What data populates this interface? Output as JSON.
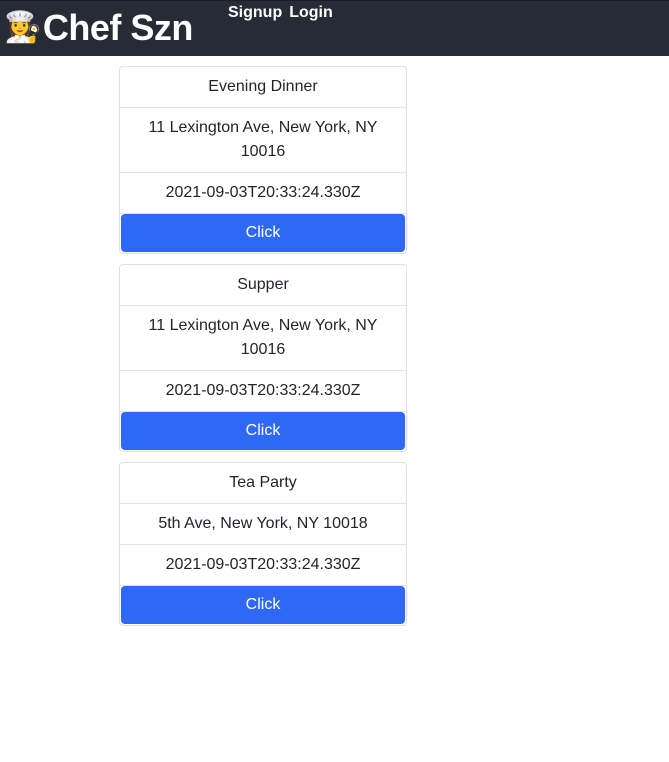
{
  "navbar": {
    "brand_icon": "👩‍🍳",
    "brand_label": "Chef Szn",
    "links": [
      "Signup",
      "Login"
    ],
    "background": "#262b35"
  },
  "events": [
    {
      "title": "Evening Dinner",
      "address": "11 Lexington Ave, New York, NY 10016",
      "date": "2021-09-03T20:33:24.330Z",
      "button_label": "Click"
    },
    {
      "title": "Supper",
      "address": "11 Lexington Ave, New York, NY 10016",
      "date": "2021-09-03T20:33:24.330Z",
      "button_label": "Click"
    },
    {
      "title": "Tea Party",
      "address": "5th Ave, New York, NY 10018",
      "date": "2021-09-03T20:33:24.330Z",
      "button_label": "Click"
    }
  ],
  "colors": {
    "button": "#3068f6",
    "card_border": "#dfe1e4"
  }
}
